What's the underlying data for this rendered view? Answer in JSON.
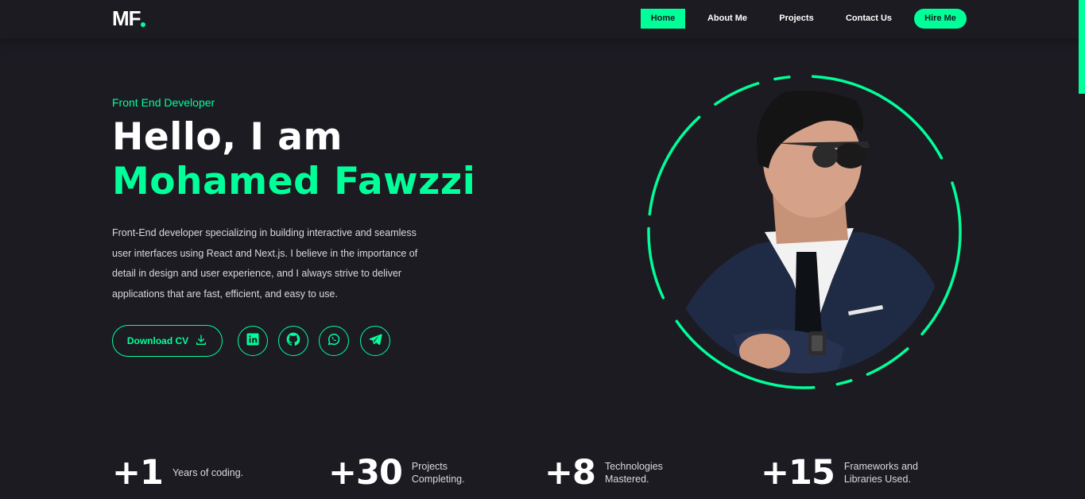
{
  "brand": {
    "logo_text": "MF",
    "accent_color": "#00ff99",
    "background_color": "#1c1b22"
  },
  "nav": {
    "home": "Home",
    "about": "About Me",
    "projects": "Projects",
    "contact": "Contact Us",
    "hire": "Hire Me"
  },
  "hero": {
    "role": "Front End Developer",
    "greeting": "Hello, I am",
    "name": "Mohamed Fawzzi",
    "description": "Front-End developer specializing in building interactive and seamless user interfaces using React and Next.js. I believe in the importance of detail in design and user experience, and I always strive to deliver applications that are fast, efficient, and easy to use.",
    "cv_button": "Download CV",
    "socials": [
      "linkedin-icon",
      "github-icon",
      "whatsapp-icon",
      "telegram-icon"
    ]
  },
  "stats": [
    {
      "value": "+1",
      "label_line1": "Years of coding.",
      "label_line2": ""
    },
    {
      "value": "+30",
      "label_line1": "Projects",
      "label_line2": "Completing."
    },
    {
      "value": "+8",
      "label_line1": "Technologies",
      "label_line2": "Mastered."
    },
    {
      "value": "+15",
      "label_line1": "Frameworks and",
      "label_line2": "Libraries Used."
    }
  ]
}
